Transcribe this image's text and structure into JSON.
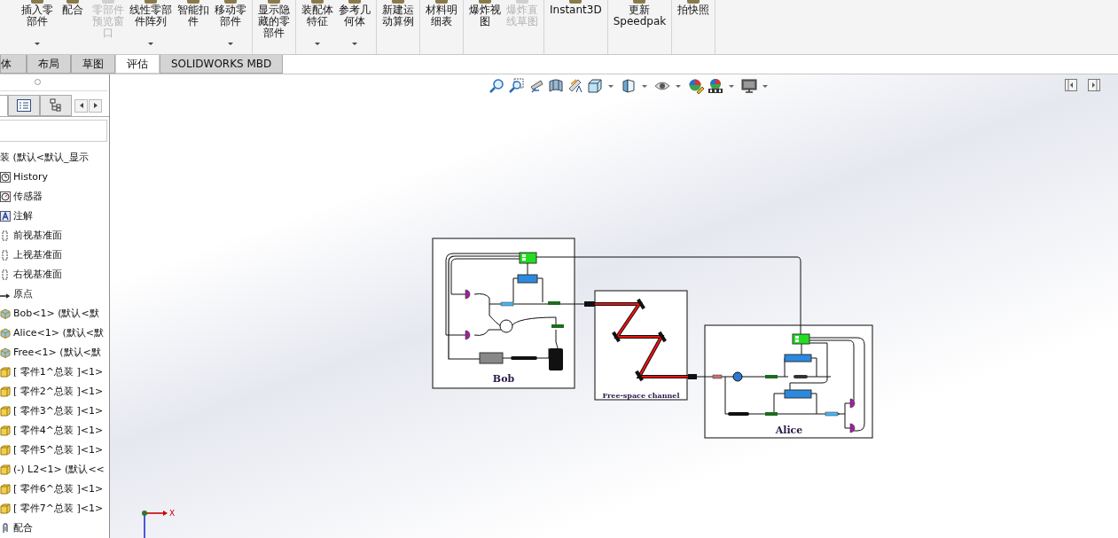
{
  "ribbon": {
    "groups": [
      {
        "buttons": [
          {
            "lines": [
              "插入零",
              "部件"
            ],
            "disabled": false,
            "dropdown": true
          },
          {
            "lines": [
              "配合"
            ],
            "disabled": false,
            "dropdown": false
          },
          {
            "lines": [
              "零部件",
              "预览窗",
              "口"
            ],
            "disabled": true,
            "dropdown": false
          },
          {
            "lines": [
              "线性零部",
              "件阵列"
            ],
            "disabled": false,
            "dropdown": true
          },
          {
            "lines": [
              "智能扣",
              "件"
            ],
            "disabled": false,
            "dropdown": false
          },
          {
            "lines": [
              "移动零",
              "部件"
            ],
            "disabled": false,
            "dropdown": true
          }
        ]
      },
      {
        "buttons": [
          {
            "lines": [
              "显示隐",
              "藏的零",
              "部件"
            ],
            "disabled": false,
            "dropdown": false
          }
        ]
      },
      {
        "buttons": [
          {
            "lines": [
              "装配体",
              "特征"
            ],
            "disabled": false,
            "dropdown": true
          },
          {
            "lines": [
              "参考几",
              "何体"
            ],
            "disabled": false,
            "dropdown": true
          }
        ]
      },
      {
        "buttons": [
          {
            "lines": [
              "新建运",
              "动算例"
            ],
            "disabled": false,
            "dropdown": false
          }
        ]
      },
      {
        "buttons": [
          {
            "lines": [
              "材料明",
              "细表"
            ],
            "disabled": false,
            "dropdown": false
          }
        ]
      },
      {
        "buttons": [
          {
            "lines": [
              "爆炸视",
              "图"
            ],
            "disabled": false,
            "dropdown": false
          },
          {
            "lines": [
              "爆炸直",
              "线草图"
            ],
            "disabled": true,
            "dropdown": false
          }
        ]
      },
      {
        "buttons": [
          {
            "lines": [
              "Instant3D"
            ],
            "disabled": false,
            "dropdown": false
          }
        ]
      },
      {
        "buttons": [
          {
            "lines": [
              "更新",
              "Speedpak"
            ],
            "disabled": false,
            "dropdown": false
          }
        ]
      },
      {
        "buttons": [
          {
            "lines": [
              "拍快照"
            ],
            "disabled": false,
            "dropdown": false
          }
        ]
      }
    ]
  },
  "tabs": [
    {
      "label": "体",
      "selected": false
    },
    {
      "label": "布局",
      "selected": false
    },
    {
      "label": "草图",
      "selected": false
    },
    {
      "label": "评估",
      "selected": true
    },
    {
      "label": "SOLIDWORKS MBD",
      "selected": false
    }
  ],
  "panel_tabs": [
    {
      "selected": true
    },
    {
      "selected": false
    },
    {
      "selected": false
    }
  ],
  "feature_tree": {
    "root": {
      "label": "装 (默认<默认_显示",
      "children": [
        {
          "label": "History",
          "kind": "history"
        },
        {
          "label": "传感器",
          "kind": "sensor"
        },
        {
          "label": "注解",
          "kind": "annotation"
        },
        {
          "label": "前视基准面",
          "kind": "plane"
        },
        {
          "label": "上视基准面",
          "kind": "plane"
        },
        {
          "label": "右视基准面",
          "kind": "plane"
        },
        {
          "label": "原点",
          "kind": "origin"
        },
        {
          "label": "Bob<1> (默认<默",
          "kind": "assembly"
        },
        {
          "label": "Alice<1> (默认<默",
          "kind": "assembly"
        },
        {
          "label": "Free<1> (默认<默",
          "kind": "assembly"
        },
        {
          "label": "[ 零件1^总装 ]<1>",
          "kind": "part"
        },
        {
          "label": "[ 零件2^总装 ]<1>",
          "kind": "part"
        },
        {
          "label": "[ 零件3^总装 ]<1>",
          "kind": "part"
        },
        {
          "label": "[ 零件4^总装 ]<1>",
          "kind": "part"
        },
        {
          "label": "[ 零件5^总装 ]<1>",
          "kind": "part"
        },
        {
          "label": "(-) L2<1> (默认<<",
          "kind": "part"
        },
        {
          "label": "[ 零件6^总装 ]<1>",
          "kind": "part"
        },
        {
          "label": "[ 零件7^总装 ]<1>",
          "kind": "part"
        },
        {
          "label": "配合",
          "kind": "mates"
        }
      ]
    }
  },
  "diagram": {
    "panels": [
      {
        "label": "Bob"
      },
      {
        "label": "Free-space channel"
      },
      {
        "label": "Alice"
      }
    ]
  },
  "triad": {
    "x_label": "X"
  }
}
